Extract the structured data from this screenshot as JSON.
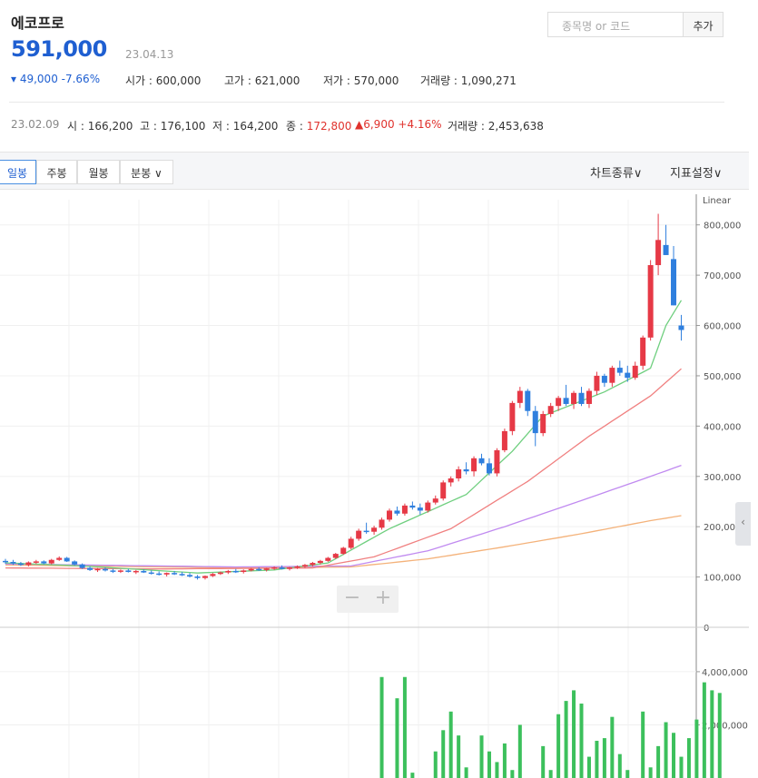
{
  "stock": {
    "name": "에코프로",
    "price": "591,000",
    "date": "23.04.13",
    "change": "▾ 49,000 -7.66%",
    "open_label": "시가 : ",
    "open": "600,000",
    "high_label": "고가 : ",
    "high": "621,000",
    "low_label": "저가 : ",
    "low": "570,000",
    "volume_label": "거래량 : ",
    "volume": "1,090,271"
  },
  "search": {
    "placeholder": "종목명 or 코드",
    "add_label": "추가"
  },
  "previous": {
    "date": "23.02.09",
    "open_label": "시 : ",
    "open": "166,200",
    "high_label": "고 : ",
    "high": "176,100",
    "low_label": "저 : ",
    "low": "164,200",
    "close_label": "종 : ",
    "close": "172,800",
    "change": "▲6,900 +4.16%",
    "volume_label": "거래량 : ",
    "volume": "2,453,638"
  },
  "tabs": [
    "일봉",
    "주봉",
    "월봉",
    "분봉 ∨"
  ],
  "menus": {
    "chart_type": "차트종류∨",
    "indicator": "지표설정∨"
  },
  "zoom": {
    "minus": "−",
    "plus": "+"
  },
  "handle": "‹",
  "colors": {
    "up": "#e63946",
    "down": "#2f7fde",
    "ma5": "#6fcf7f",
    "ma20": "#f08080",
    "ma60": "#c08af0",
    "ma120": "#f4b27a",
    "volume": "#3cc05c"
  },
  "chart_data": [
    {
      "type": "candlestick",
      "scale": "Linear",
      "ylim": [
        0,
        850000
      ],
      "yticks": [
        {
          "v": 0,
          "label": "0"
        },
        {
          "v": 100000,
          "label": "100,000"
        },
        {
          "v": 200000,
          "label": "200,000"
        },
        {
          "v": 300000,
          "label": "300,000"
        },
        {
          "v": 400000,
          "label": "400,000"
        },
        {
          "v": 500000,
          "label": "500,000"
        },
        {
          "v": 600000,
          "label": "600,000"
        },
        {
          "v": 700000,
          "label": "700,000"
        },
        {
          "v": 800000,
          "label": "800,000"
        }
      ],
      "scale_label": "Linear",
      "grid": true,
      "candles": [
        [
          132,
          136,
          126,
          130
        ],
        [
          130,
          134,
          124,
          127
        ],
        [
          127,
          130,
          122,
          124
        ],
        [
          124,
          131,
          121,
          129
        ],
        [
          129,
          134,
          126,
          131
        ],
        [
          131,
          133,
          125,
          127
        ],
        [
          127,
          136,
          125,
          134
        ],
        [
          134,
          141,
          132,
          138
        ],
        [
          138,
          140,
          130,
          131
        ],
        [
          131,
          133,
          123,
          125
        ],
        [
          125,
          127,
          116,
          118
        ],
        [
          118,
          121,
          112,
          114
        ],
        [
          114,
          118,
          110,
          116
        ],
        [
          116,
          119,
          111,
          113
        ],
        [
          113,
          116,
          108,
          111
        ],
        [
          111,
          115,
          108,
          113
        ],
        [
          113,
          116,
          109,
          110
        ],
        [
          110,
          114,
          106,
          112
        ],
        [
          112,
          115,
          108,
          109
        ],
        [
          109,
          113,
          105,
          107
        ],
        [
          107,
          111,
          103,
          105
        ],
        [
          105,
          109,
          101,
          108
        ],
        [
          108,
          112,
          104,
          106
        ],
        [
          106,
          110,
          102,
          104
        ],
        [
          104,
          108,
          99,
          101
        ],
        [
          101,
          104,
          95,
          98
        ],
        [
          98,
          103,
          95,
          102
        ],
        [
          102,
          108,
          100,
          106
        ],
        [
          106,
          111,
          104,
          109
        ],
        [
          109,
          114,
          106,
          112
        ],
        [
          112,
          116,
          108,
          110
        ],
        [
          110,
          115,
          107,
          113
        ],
        [
          113,
          118,
          111,
          116
        ],
        [
          116,
          119,
          112,
          114
        ],
        [
          114,
          118,
          111,
          117
        ],
        [
          117,
          121,
          114,
          119
        ],
        [
          119,
          123,
          115,
          116
        ],
        [
          116,
          120,
          113,
          119
        ],
        [
          119,
          123,
          116,
          121
        ],
        [
          121,
          126,
          118,
          124
        ],
        [
          124,
          130,
          121,
          128
        ],
        [
          128,
          134,
          125,
          132
        ],
        [
          132,
          140,
          130,
          138
        ],
        [
          138,
          148,
          136,
          146
        ],
        [
          146,
          160,
          144,
          158
        ],
        [
          158,
          180,
          155,
          176
        ],
        [
          176,
          196,
          172,
          192
        ],
        [
          192,
          208,
          186,
          190
        ],
        [
          190,
          202,
          184,
          198
        ],
        [
          198,
          218,
          194,
          214
        ],
        [
          214,
          236,
          210,
          232
        ],
        [
          232,
          240,
          222,
          226
        ],
        [
          226,
          246,
          222,
          242
        ],
        [
          242,
          250,
          234,
          238
        ],
        [
          238,
          246,
          224,
          232
        ],
        [
          232,
          252,
          228,
          248
        ],
        [
          248,
          262,
          244,
          256
        ],
        [
          256,
          292,
          252,
          288
        ],
        [
          288,
          300,
          280,
          296
        ],
        [
          296,
          320,
          290,
          314
        ],
        [
          314,
          328,
          304,
          310
        ],
        [
          310,
          340,
          300,
          336
        ],
        [
          336,
          345,
          322,
          326
        ],
        [
          326,
          336,
          302,
          306
        ],
        [
          306,
          356,
          300,
          352
        ],
        [
          352,
          395,
          348,
          390
        ],
        [
          390,
          450,
          382,
          446
        ],
        [
          446,
          478,
          436,
          470
        ],
        [
          470,
          474,
          420,
          430
        ],
        [
          430,
          440,
          360,
          386
        ],
        [
          386,
          430,
          380,
          424
        ],
        [
          424,
          446,
          418,
          440
        ],
        [
          440,
          460,
          430,
          456
        ],
        [
          456,
          482,
          440,
          444
        ],
        [
          444,
          470,
          434,
          466
        ],
        [
          466,
          478,
          440,
          444
        ],
        [
          444,
          475,
          436,
          470
        ],
        [
          470,
          508,
          462,
          500
        ],
        [
          500,
          504,
          478,
          486
        ],
        [
          486,
          520,
          478,
          516
        ],
        [
          516,
          530,
          500,
          506
        ],
        [
          506,
          520,
          488,
          496
        ],
        [
          496,
          528,
          492,
          520
        ],
        [
          520,
          580,
          512,
          576
        ],
        [
          576,
          730,
          570,
          720
        ],
        [
          720,
          822,
          700,
          770
        ],
        [
          760,
          800,
          740,
          740
        ],
        [
          732,
          758,
          640,
          640
        ],
        [
          600,
          621,
          570,
          591
        ]
      ],
      "ma5_anchors": [
        [
          0,
          128
        ],
        [
          10,
          122
        ],
        [
          25,
          108
        ],
        [
          35,
          114
        ],
        [
          42,
          128
        ],
        [
          50,
          196
        ],
        [
          60,
          264
        ],
        [
          66,
          350
        ],
        [
          70,
          420
        ],
        [
          78,
          468
        ],
        [
          84,
          515
        ],
        [
          86,
          600
        ],
        [
          88,
          650
        ]
      ],
      "ma20_anchors": [
        [
          0,
          118
        ],
        [
          20,
          116
        ],
        [
          40,
          118
        ],
        [
          48,
          140
        ],
        [
          58,
          196
        ],
        [
          68,
          290
        ],
        [
          76,
          380
        ],
        [
          84,
          460
        ],
        [
          88,
          514
        ]
      ],
      "ma60_anchors": [
        [
          0,
          126
        ],
        [
          30,
          120
        ],
        [
          45,
          122
        ],
        [
          55,
          152
        ],
        [
          65,
          200
        ],
        [
          75,
          252
        ],
        [
          84,
          300
        ],
        [
          88,
          322
        ]
      ],
      "ma120_anchors": [
        [
          0,
          124
        ],
        [
          30,
          118
        ],
        [
          45,
          120
        ],
        [
          55,
          136
        ],
        [
          65,
          160
        ],
        [
          75,
          186
        ],
        [
          84,
          212
        ],
        [
          88,
          222
        ]
      ]
    },
    {
      "type": "bar",
      "title": "volume",
      "ylim": [
        0,
        5500000
      ],
      "yticks": [
        {
          "v": 2000000,
          "label": "2,000,000"
        },
        {
          "v": 4000000,
          "label": "4,000,000"
        }
      ],
      "values": [
        [
          49,
          3800000
        ],
        [
          51,
          3000000
        ],
        [
          52,
          3800000
        ],
        [
          53,
          200000
        ],
        [
          56,
          1000000
        ],
        [
          57,
          1800000
        ],
        [
          58,
          2500000
        ],
        [
          59,
          1600000
        ],
        [
          60,
          400000
        ],
        [
          62,
          1600000
        ],
        [
          63,
          1000000
        ],
        [
          64,
          600000
        ],
        [
          65,
          1300000
        ],
        [
          66,
          300000
        ],
        [
          67,
          2000000
        ],
        [
          70,
          1200000
        ],
        [
          71,
          300000
        ],
        [
          72,
          2400000
        ],
        [
          73,
          2900000
        ],
        [
          74,
          3300000
        ],
        [
          75,
          2800000
        ],
        [
          76,
          800000
        ],
        [
          77,
          1400000
        ],
        [
          78,
          1500000
        ],
        [
          79,
          2300000
        ],
        [
          80,
          900000
        ],
        [
          81,
          300000
        ],
        [
          83,
          2500000
        ],
        [
          84,
          400000
        ],
        [
          85,
          1200000
        ],
        [
          86,
          2100000
        ],
        [
          87,
          1700000
        ],
        [
          88,
          800000
        ],
        [
          89,
          1500000
        ],
        [
          90,
          2200000
        ],
        [
          91,
          3600000
        ],
        [
          92,
          3300000
        ],
        [
          93,
          3200000
        ]
      ]
    }
  ]
}
